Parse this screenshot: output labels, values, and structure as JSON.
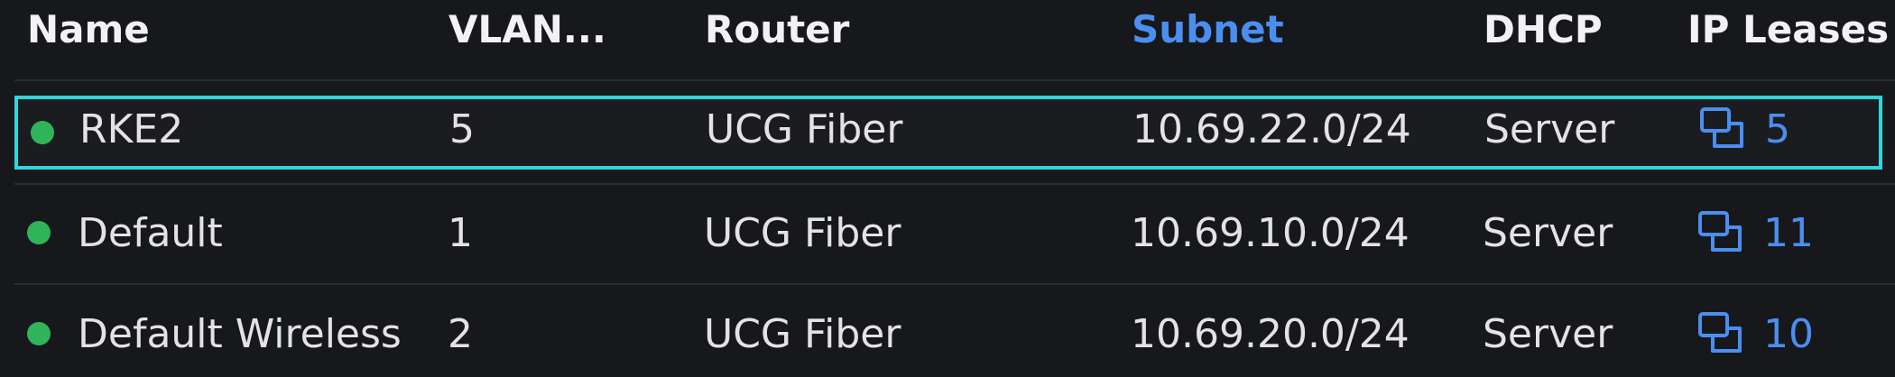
{
  "columns": {
    "name": "Name",
    "vlan": "VLAN...",
    "router": "Router",
    "subnet": "Subnet",
    "dhcp": "DHCP",
    "ip_leases": "IP Leases"
  },
  "sorted_column": "subnet",
  "colors": {
    "status_online": "#2fb45a",
    "accent": "#4a8ff0",
    "selection": "#2fd6dc"
  },
  "rows": [
    {
      "status": "online",
      "name": "RKE2",
      "vlan": "5",
      "router": "UCG Fiber",
      "subnet": "10.69.22.0/24",
      "dhcp": "Server",
      "ip_leases": "5",
      "lease_icon": "clients-icon",
      "selected": true
    },
    {
      "status": "online",
      "name": "Default",
      "vlan": "1",
      "router": "UCG Fiber",
      "subnet": "10.69.10.0/24",
      "dhcp": "Server",
      "ip_leases": "11",
      "lease_icon": "clients-icon",
      "selected": false
    },
    {
      "status": "online",
      "name": "Default Wireless",
      "vlan": "2",
      "router": "UCG Fiber",
      "subnet": "10.69.20.0/24",
      "dhcp": "Server",
      "ip_leases": "10",
      "lease_icon": "clients-icon",
      "selected": false
    }
  ]
}
